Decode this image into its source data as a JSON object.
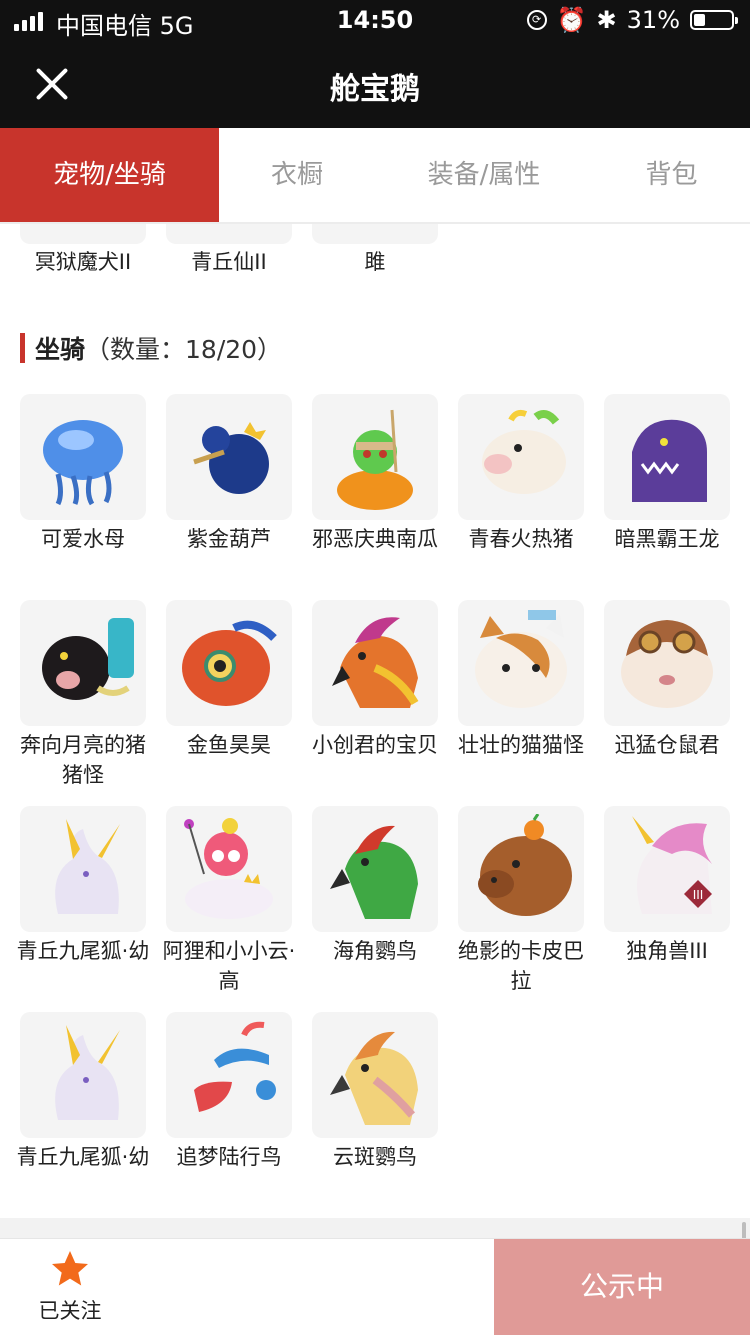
{
  "status_bar": {
    "carrier": "中国电信  5G",
    "time": "14:50",
    "battery": "31%",
    "battery_level": 0.31
  },
  "nav": {
    "title": "舱宝鹅"
  },
  "tabs": [
    {
      "label": "宠物/坐骑",
      "active": true
    },
    {
      "label": "衣橱",
      "active": false
    },
    {
      "label": "装备/属性",
      "active": false
    },
    {
      "label": "背包",
      "active": false
    }
  ],
  "previous_section_items": [
    "冥狱魔犬II",
    "青丘仙II",
    "雎"
  ],
  "mounts": {
    "heading": "坐骑",
    "count_text": "（数量：18/20）",
    "items": [
      {
        "name": "可爱水母",
        "icon": "jellyfish-icon"
      },
      {
        "name": "紫金葫芦",
        "icon": "gourd-icon"
      },
      {
        "name": "邪恶庆典南瓜",
        "icon": "pumpkin-icon"
      },
      {
        "name": "青春火热猪",
        "icon": "pig-icon"
      },
      {
        "name": "暗黑霸王龙",
        "icon": "dinosaur-icon"
      },
      {
        "name": "奔向月亮的猪猪怪",
        "icon": "black-pig-icon"
      },
      {
        "name": "金鱼昊昊",
        "icon": "goldfish-icon"
      },
      {
        "name": "小创君的宝贝",
        "icon": "phoenix-icon"
      },
      {
        "name": "壮壮的猫猫怪",
        "icon": "cat-icon"
      },
      {
        "name": "迅猛仓鼠君",
        "icon": "hamster-icon"
      },
      {
        "name": "青丘九尾狐·幼",
        "icon": "fox-icon"
      },
      {
        "name": "阿狸和小小云·高",
        "icon": "ali-cloud-icon"
      },
      {
        "name": "海角鹦鸟",
        "icon": "parrot-icon"
      },
      {
        "name": "绝影的卡皮巴拉",
        "icon": "capybara-icon"
      },
      {
        "name": "独角兽III",
        "icon": "unicorn-icon"
      },
      {
        "name": "青丘九尾狐·幼",
        "icon": "fox-icon"
      },
      {
        "name": "追梦陆行鸟",
        "icon": "bird-headphone-icon"
      },
      {
        "name": "云斑鹦鸟",
        "icon": "cockatoo-icon"
      }
    ]
  },
  "bottom": {
    "follow_label": "已关注",
    "publish_label": "公示中"
  },
  "colors": {
    "accent": "#c8342c",
    "publish_bg": "#e09a97",
    "star": "#f26a1b"
  }
}
